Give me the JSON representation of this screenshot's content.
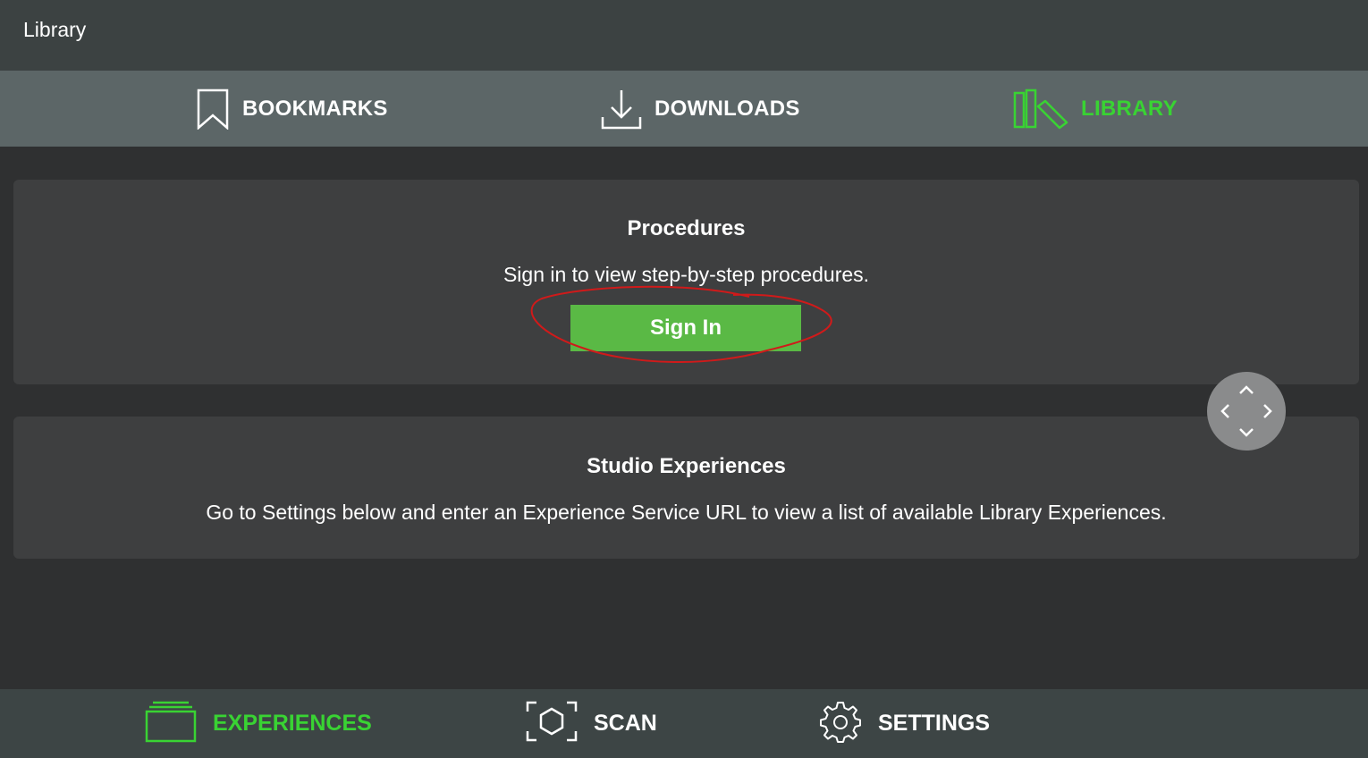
{
  "app": {
    "title": "Library"
  },
  "top_tabs": [
    {
      "label": "BOOKMARKS",
      "icon": "bookmark-icon",
      "active": false
    },
    {
      "label": "DOWNLOADS",
      "icon": "download-icon",
      "active": false
    },
    {
      "label": "LIBRARY",
      "icon": "library-icon",
      "active": true
    }
  ],
  "procedures": {
    "title": "Procedures",
    "text": "Sign in to view step-by-step procedures.",
    "button_label": "Sign In"
  },
  "studio": {
    "title": "Studio Experiences",
    "text": "Go to Settings below and enter an Experience Service URL to view a list of available Library Experiences."
  },
  "bottom_tabs": [
    {
      "label": "EXPERIENCES",
      "icon": "experiences-icon",
      "active": true
    },
    {
      "label": "SCAN",
      "icon": "scan-icon",
      "active": false
    },
    {
      "label": "SETTINGS",
      "icon": "gear-icon",
      "active": false
    }
  ],
  "colors": {
    "accent": "#39d333",
    "button": "#5ab945",
    "annotation": "#d01a1a"
  }
}
